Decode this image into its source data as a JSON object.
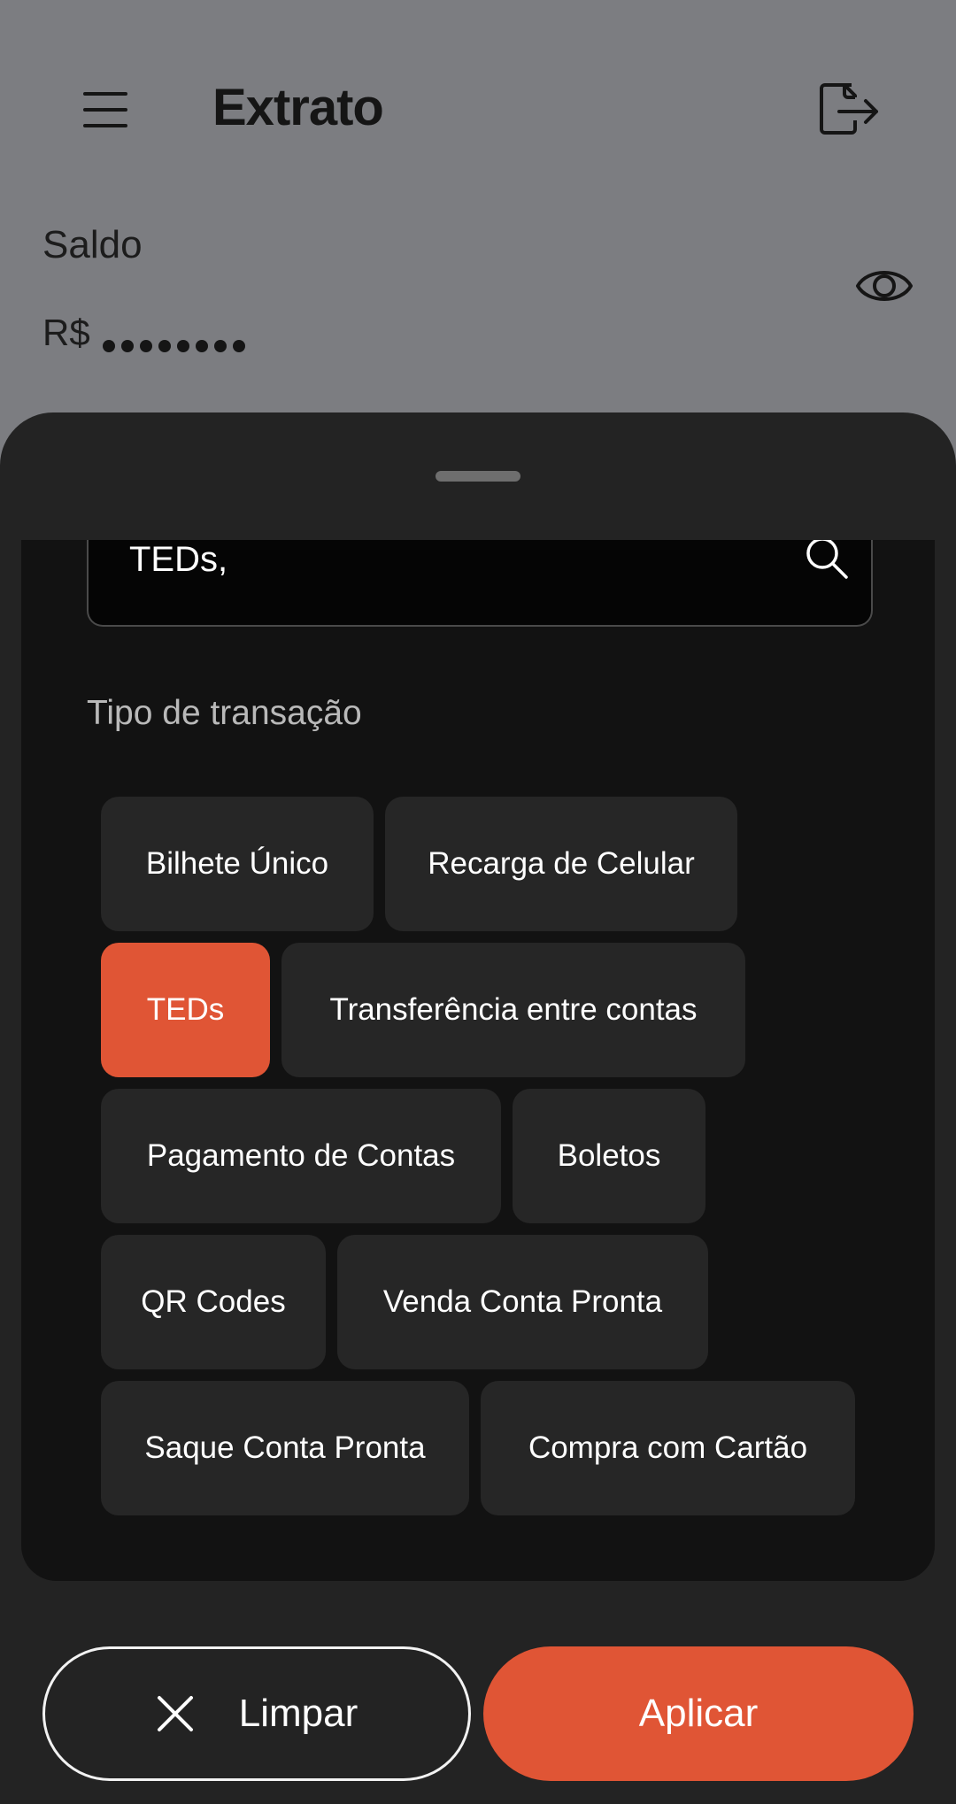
{
  "header": {
    "title": "Extrato",
    "balance_label": "Saldo",
    "currency": "R$",
    "balance_hidden_dots": 8
  },
  "filter_sheet": {
    "search": {
      "value": "TEDs,"
    },
    "section_title": "Tipo de transação",
    "chips": [
      {
        "label": "Bilhete Único",
        "selected": false
      },
      {
        "label": "Recarga de Celular",
        "selected": false
      },
      {
        "label": "TEDs",
        "selected": true
      },
      {
        "label": "Transferência entre contas",
        "selected": false
      },
      {
        "label": "Pagamento de Contas",
        "selected": false
      },
      {
        "label": "Boletos",
        "selected": false
      },
      {
        "label": "QR Codes",
        "selected": false
      },
      {
        "label": "Venda Conta Pronta",
        "selected": false
      },
      {
        "label": "Saque Conta Pronta",
        "selected": false
      },
      {
        "label": "Compra com Cartão",
        "selected": false
      }
    ]
  },
  "actions": {
    "clear_label": "Limpar",
    "apply_label": "Aplicar"
  },
  "colors": {
    "accent": "#e05535",
    "overlay": "#7c7d81",
    "sheet": "#232323",
    "panel": "#121212"
  }
}
